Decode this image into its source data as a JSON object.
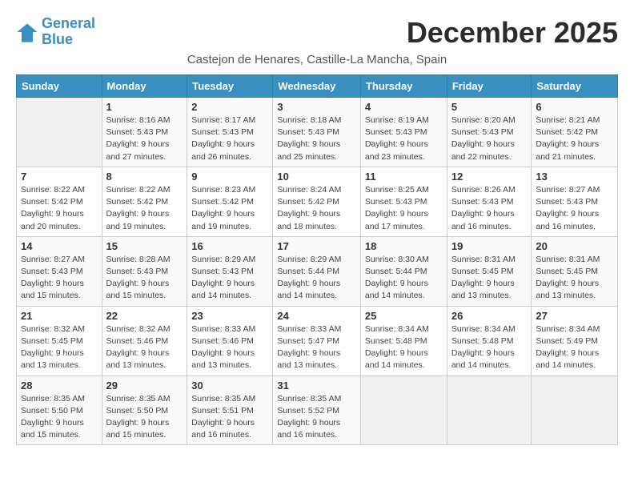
{
  "logo": {
    "line1": "General",
    "line2": "Blue"
  },
  "title": "December 2025",
  "subtitle": "Castejon de Henares, Castille-La Mancha, Spain",
  "headers": [
    "Sunday",
    "Monday",
    "Tuesday",
    "Wednesday",
    "Thursday",
    "Friday",
    "Saturday"
  ],
  "weeks": [
    [
      {
        "day": "",
        "sunrise": "",
        "sunset": "",
        "daylight": ""
      },
      {
        "day": "1",
        "sunrise": "Sunrise: 8:16 AM",
        "sunset": "Sunset: 5:43 PM",
        "daylight": "Daylight: 9 hours and 27 minutes."
      },
      {
        "day": "2",
        "sunrise": "Sunrise: 8:17 AM",
        "sunset": "Sunset: 5:43 PM",
        "daylight": "Daylight: 9 hours and 26 minutes."
      },
      {
        "day": "3",
        "sunrise": "Sunrise: 8:18 AM",
        "sunset": "Sunset: 5:43 PM",
        "daylight": "Daylight: 9 hours and 25 minutes."
      },
      {
        "day": "4",
        "sunrise": "Sunrise: 8:19 AM",
        "sunset": "Sunset: 5:43 PM",
        "daylight": "Daylight: 9 hours and 23 minutes."
      },
      {
        "day": "5",
        "sunrise": "Sunrise: 8:20 AM",
        "sunset": "Sunset: 5:43 PM",
        "daylight": "Daylight: 9 hours and 22 minutes."
      },
      {
        "day": "6",
        "sunrise": "Sunrise: 8:21 AM",
        "sunset": "Sunset: 5:42 PM",
        "daylight": "Daylight: 9 hours and 21 minutes."
      }
    ],
    [
      {
        "day": "7",
        "sunrise": "Sunrise: 8:22 AM",
        "sunset": "Sunset: 5:42 PM",
        "daylight": "Daylight: 9 hours and 20 minutes."
      },
      {
        "day": "8",
        "sunrise": "Sunrise: 8:22 AM",
        "sunset": "Sunset: 5:42 PM",
        "daylight": "Daylight: 9 hours and 19 minutes."
      },
      {
        "day": "9",
        "sunrise": "Sunrise: 8:23 AM",
        "sunset": "Sunset: 5:42 PM",
        "daylight": "Daylight: 9 hours and 19 minutes."
      },
      {
        "day": "10",
        "sunrise": "Sunrise: 8:24 AM",
        "sunset": "Sunset: 5:42 PM",
        "daylight": "Daylight: 9 hours and 18 minutes."
      },
      {
        "day": "11",
        "sunrise": "Sunrise: 8:25 AM",
        "sunset": "Sunset: 5:43 PM",
        "daylight": "Daylight: 9 hours and 17 minutes."
      },
      {
        "day": "12",
        "sunrise": "Sunrise: 8:26 AM",
        "sunset": "Sunset: 5:43 PM",
        "daylight": "Daylight: 9 hours and 16 minutes."
      },
      {
        "day": "13",
        "sunrise": "Sunrise: 8:27 AM",
        "sunset": "Sunset: 5:43 PM",
        "daylight": "Daylight: 9 hours and 16 minutes."
      }
    ],
    [
      {
        "day": "14",
        "sunrise": "Sunrise: 8:27 AM",
        "sunset": "Sunset: 5:43 PM",
        "daylight": "Daylight: 9 hours and 15 minutes."
      },
      {
        "day": "15",
        "sunrise": "Sunrise: 8:28 AM",
        "sunset": "Sunset: 5:43 PM",
        "daylight": "Daylight: 9 hours and 15 minutes."
      },
      {
        "day": "16",
        "sunrise": "Sunrise: 8:29 AM",
        "sunset": "Sunset: 5:43 PM",
        "daylight": "Daylight: 9 hours and 14 minutes."
      },
      {
        "day": "17",
        "sunrise": "Sunrise: 8:29 AM",
        "sunset": "Sunset: 5:44 PM",
        "daylight": "Daylight: 9 hours and 14 minutes."
      },
      {
        "day": "18",
        "sunrise": "Sunrise: 8:30 AM",
        "sunset": "Sunset: 5:44 PM",
        "daylight": "Daylight: 9 hours and 14 minutes."
      },
      {
        "day": "19",
        "sunrise": "Sunrise: 8:31 AM",
        "sunset": "Sunset: 5:45 PM",
        "daylight": "Daylight: 9 hours and 13 minutes."
      },
      {
        "day": "20",
        "sunrise": "Sunrise: 8:31 AM",
        "sunset": "Sunset: 5:45 PM",
        "daylight": "Daylight: 9 hours and 13 minutes."
      }
    ],
    [
      {
        "day": "21",
        "sunrise": "Sunrise: 8:32 AM",
        "sunset": "Sunset: 5:45 PM",
        "daylight": "Daylight: 9 hours and 13 minutes."
      },
      {
        "day": "22",
        "sunrise": "Sunrise: 8:32 AM",
        "sunset": "Sunset: 5:46 PM",
        "daylight": "Daylight: 9 hours and 13 minutes."
      },
      {
        "day": "23",
        "sunrise": "Sunrise: 8:33 AM",
        "sunset": "Sunset: 5:46 PM",
        "daylight": "Daylight: 9 hours and 13 minutes."
      },
      {
        "day": "24",
        "sunrise": "Sunrise: 8:33 AM",
        "sunset": "Sunset: 5:47 PM",
        "daylight": "Daylight: 9 hours and 13 minutes."
      },
      {
        "day": "25",
        "sunrise": "Sunrise: 8:34 AM",
        "sunset": "Sunset: 5:48 PM",
        "daylight": "Daylight: 9 hours and 14 minutes."
      },
      {
        "day": "26",
        "sunrise": "Sunrise: 8:34 AM",
        "sunset": "Sunset: 5:48 PM",
        "daylight": "Daylight: 9 hours and 14 minutes."
      },
      {
        "day": "27",
        "sunrise": "Sunrise: 8:34 AM",
        "sunset": "Sunset: 5:49 PM",
        "daylight": "Daylight: 9 hours and 14 minutes."
      }
    ],
    [
      {
        "day": "28",
        "sunrise": "Sunrise: 8:35 AM",
        "sunset": "Sunset: 5:50 PM",
        "daylight": "Daylight: 9 hours and 15 minutes."
      },
      {
        "day": "29",
        "sunrise": "Sunrise: 8:35 AM",
        "sunset": "Sunset: 5:50 PM",
        "daylight": "Daylight: 9 hours and 15 minutes."
      },
      {
        "day": "30",
        "sunrise": "Sunrise: 8:35 AM",
        "sunset": "Sunset: 5:51 PM",
        "daylight": "Daylight: 9 hours and 16 minutes."
      },
      {
        "day": "31",
        "sunrise": "Sunrise: 8:35 AM",
        "sunset": "Sunset: 5:52 PM",
        "daylight": "Daylight: 9 hours and 16 minutes."
      },
      {
        "day": "",
        "sunrise": "",
        "sunset": "",
        "daylight": ""
      },
      {
        "day": "",
        "sunrise": "",
        "sunset": "",
        "daylight": ""
      },
      {
        "day": "",
        "sunrise": "",
        "sunset": "",
        "daylight": ""
      }
    ]
  ]
}
